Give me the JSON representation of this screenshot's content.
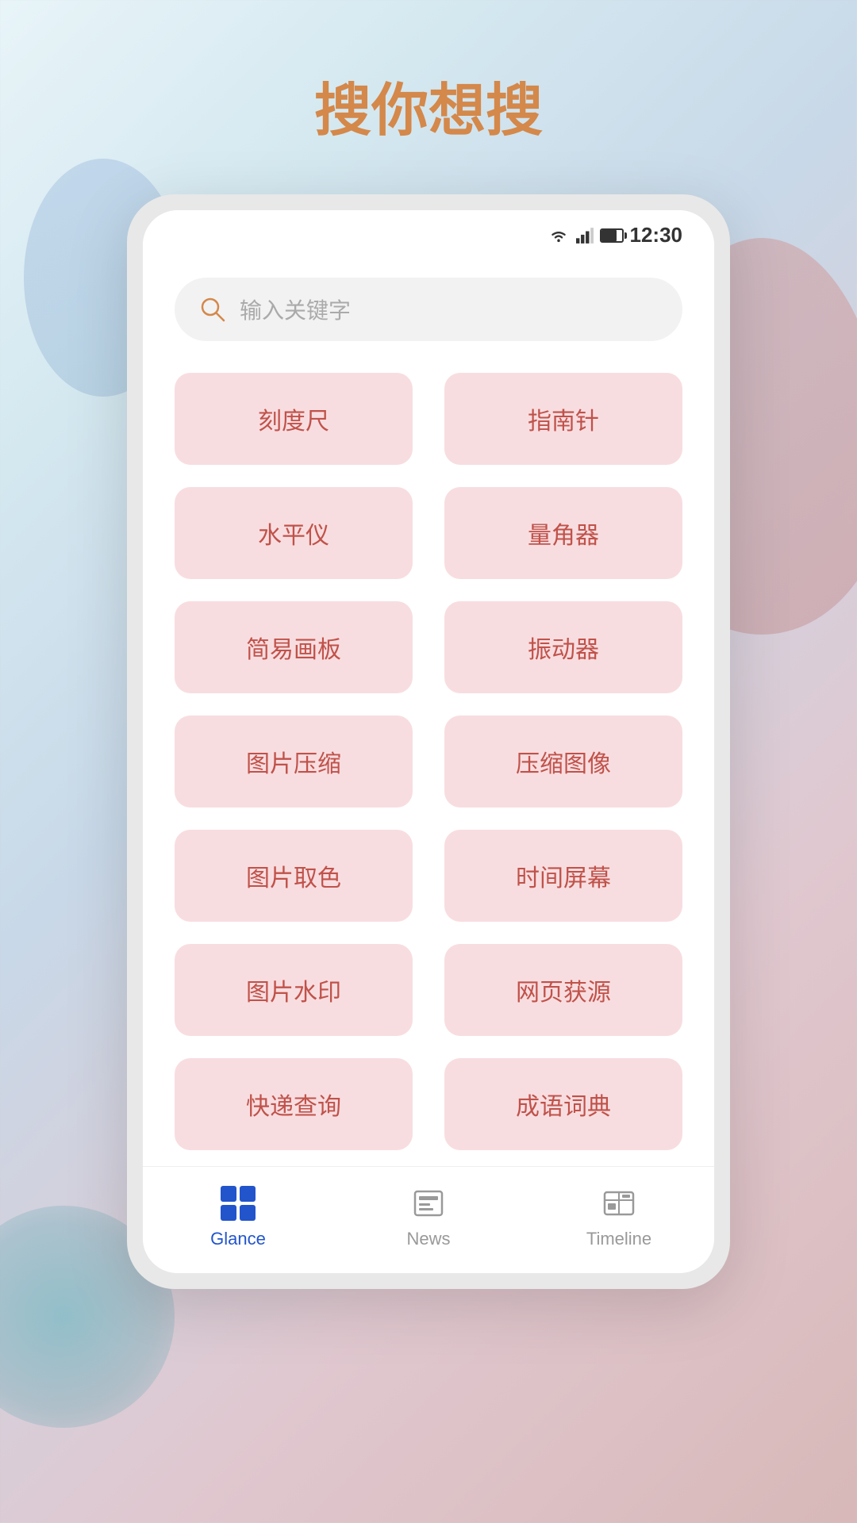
{
  "header": {
    "title": "搜你想搜"
  },
  "status_bar": {
    "time": "12:30"
  },
  "search": {
    "placeholder": "输入关键字"
  },
  "tools": [
    {
      "id": "ruler",
      "label": "刻度尺"
    },
    {
      "id": "compass",
      "label": "指南针"
    },
    {
      "id": "level",
      "label": "水平仪"
    },
    {
      "id": "protractor",
      "label": "量角器"
    },
    {
      "id": "sketchpad",
      "label": "简易画板"
    },
    {
      "id": "vibrator",
      "label": "振动器"
    },
    {
      "id": "img-compress",
      "label": "图片压缩"
    },
    {
      "id": "img-compress2",
      "label": "压缩图像"
    },
    {
      "id": "color-picker",
      "label": "图片取色"
    },
    {
      "id": "time-screen",
      "label": "时间屏幕"
    },
    {
      "id": "watermark",
      "label": "图片水印"
    },
    {
      "id": "webpage-src",
      "label": "网页获源"
    },
    {
      "id": "express-query",
      "label": "快递查询"
    },
    {
      "id": "idiom-dict",
      "label": "成语词典"
    }
  ],
  "bottom_nav": {
    "items": [
      {
        "id": "glance",
        "label": "Glance",
        "active": true
      },
      {
        "id": "news",
        "label": "News",
        "active": false
      },
      {
        "id": "timeline",
        "label": "Timeline",
        "active": false
      }
    ]
  },
  "colors": {
    "accent": "#d4884a",
    "tool_bg": "#f8dde0",
    "tool_text": "#c0524a",
    "nav_active": "#2255cc",
    "nav_inactive": "#999999"
  }
}
